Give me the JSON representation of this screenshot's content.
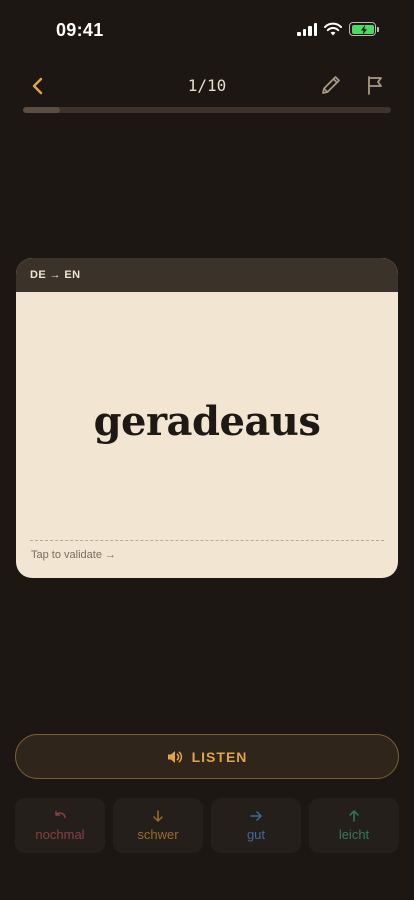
{
  "status": {
    "time": "09:41"
  },
  "header": {
    "counter": "1/10"
  },
  "progress": {
    "current": 1,
    "total": 10
  },
  "card": {
    "direction": "DE → EN",
    "word": "geradeaus",
    "hint": "Tap to validate →"
  },
  "listen": {
    "label": "LISTEN"
  },
  "ratings": [
    {
      "label": "nochmal",
      "color": "#8a3f42",
      "icon": "undo-arrow-icon"
    },
    {
      "label": "schwer",
      "color": "#9a6a2c",
      "icon": "arrow-down-icon"
    },
    {
      "label": "gut",
      "color": "#3f6a99",
      "icon": "arrow-right-icon"
    },
    {
      "label": "leicht",
      "color": "#2f7a5c",
      "icon": "arrow-up-icon"
    }
  ],
  "colors": {
    "background": "#1d1714",
    "accent": "#e0a54a",
    "card": "#f2e6d2"
  }
}
